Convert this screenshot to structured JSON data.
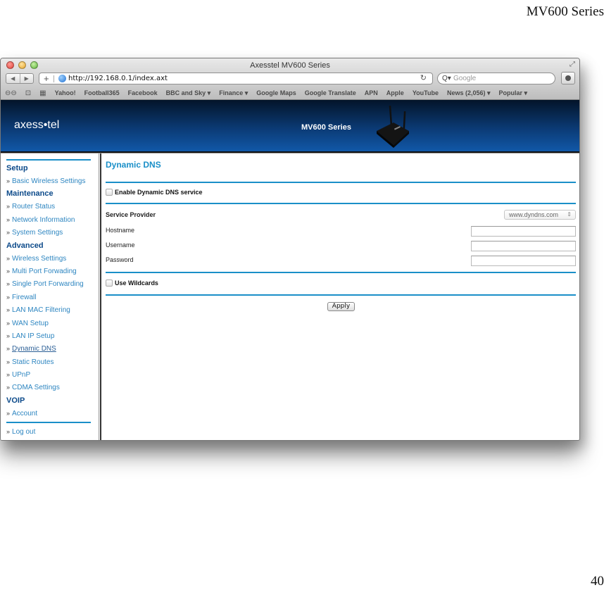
{
  "document": {
    "header": "MV600 Series",
    "page_number": "40"
  },
  "browser": {
    "window_title": "Axesstel MV600 Series",
    "nav_back_icon": "◀",
    "nav_forward_icon": "▶",
    "new_tab_icon": "+",
    "url": "http://192.168.0.1/index.axt",
    "reload_icon": "↻",
    "search_icon": "Q▾",
    "search_placeholder": "Google",
    "bookmark_icons": {
      "reading_list": "👓",
      "bookmarks": "📖",
      "top_sites": "▦"
    },
    "bookmarks": [
      "Yahoo!",
      "Football365",
      "Facebook",
      "BBC and Sky ▾",
      "Finance ▾",
      "Google Maps",
      "Google Translate",
      "APN",
      "Apple",
      "YouTube",
      "News (2,056) ▾",
      "Popular ▾"
    ]
  },
  "banner": {
    "logo": "axess•tel",
    "model": "MV600 Series"
  },
  "sidebar": {
    "bullet": "»",
    "sections": [
      {
        "heading": "Setup",
        "items": [
          "Basic Wireless Settings"
        ]
      },
      {
        "heading": "Maintenance",
        "items": [
          "Router Status",
          "Network Information",
          "System Settings"
        ]
      },
      {
        "heading": "Advanced",
        "items": [
          "Wireless Settings",
          "Multi Port Forwading",
          "Single Port Forwarding",
          "Firewall",
          "LAN MAC Filtering",
          "WAN Setup",
          "LAN IP Setup",
          "Dynamic DNS",
          "Static Routes",
          "UPnP",
          "CDMA Settings"
        ]
      },
      {
        "heading": "VOIP",
        "items": [
          "Account"
        ]
      }
    ],
    "logout": "Log out",
    "active_item": "Dynamic DNS"
  },
  "main": {
    "title": "Dynamic DNS",
    "enable_label": "Enable Dynamic DNS service",
    "enable_checked": false,
    "service_provider_label": "Service Provider",
    "service_provider_value": "www.dyndns.com",
    "hostname_label": "Hostname",
    "hostname_value": "",
    "username_label": "Username",
    "username_value": "",
    "password_label": "Password",
    "password_value": "",
    "wildcards_label": "Use Wildcards",
    "wildcards_checked": false,
    "apply_label": "Apply"
  },
  "colors": {
    "accent": "#1a8fc8",
    "heading": "#0c4a8a",
    "link": "#2e86c1",
    "banner_top": "#031429",
    "banner_bottom": "#1158a8"
  }
}
